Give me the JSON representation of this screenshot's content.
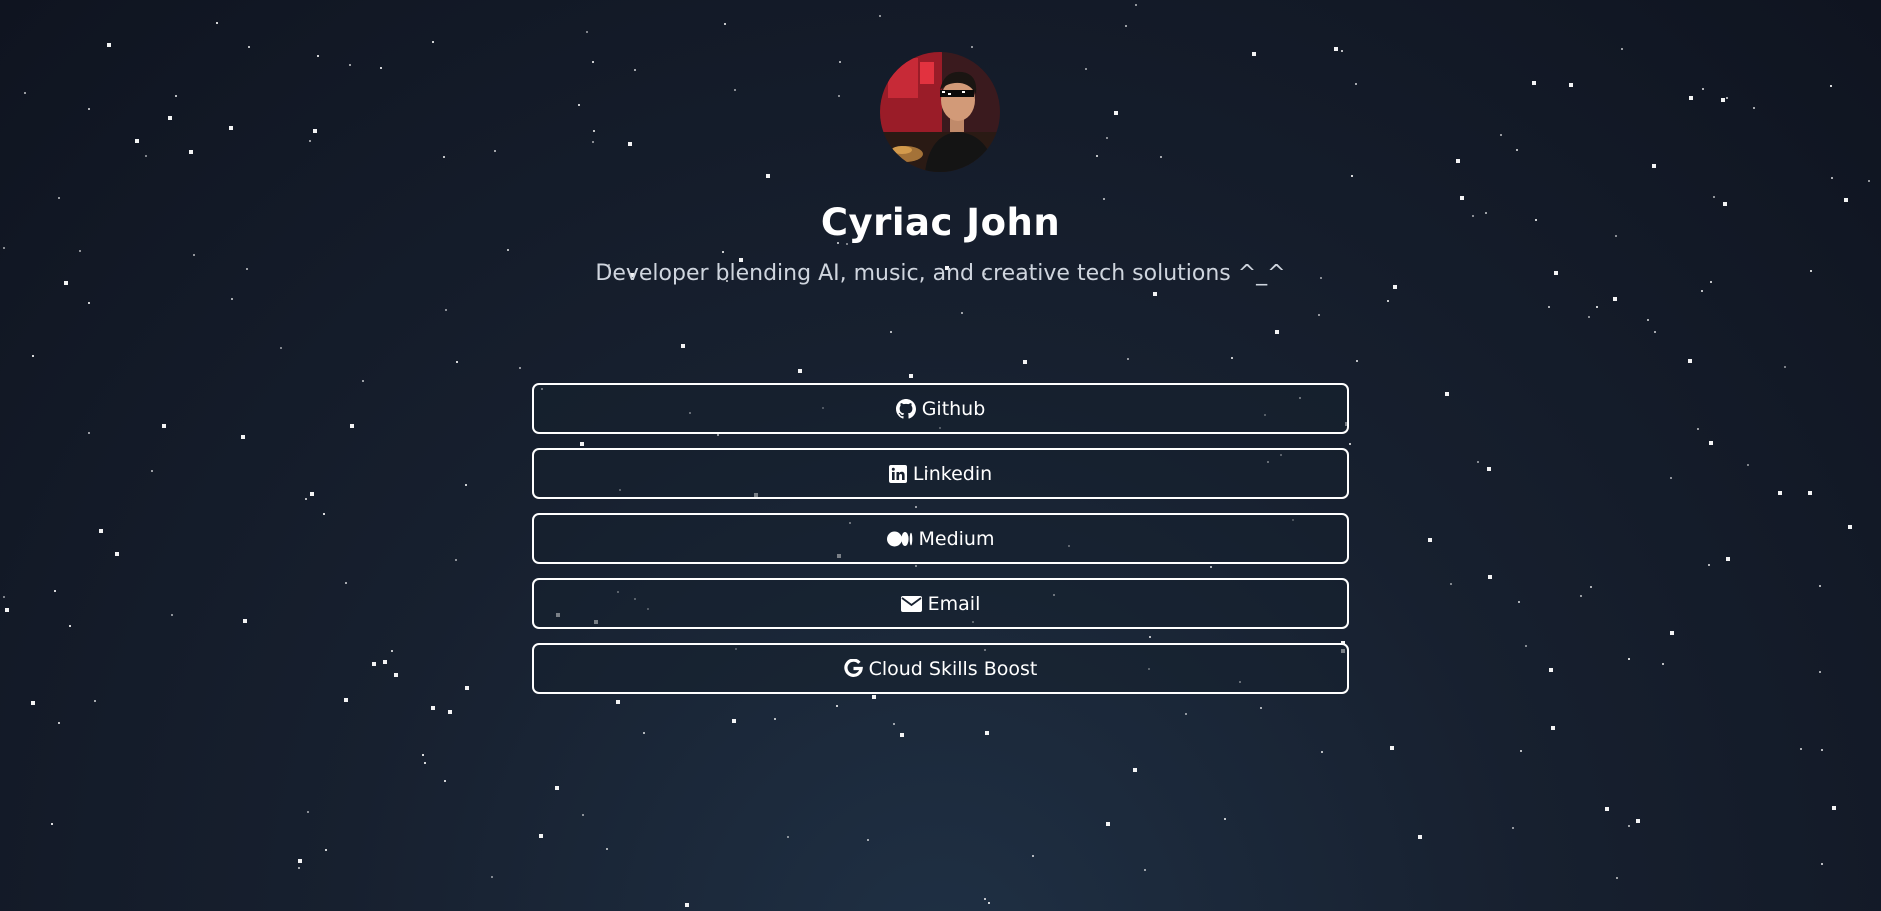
{
  "profile": {
    "name": "Cyriac John",
    "bio": "Developer blending AI, music, and creative tech solutions ^_^",
    "avatar_alt": "profile photo"
  },
  "links": [
    {
      "label": "Github",
      "icon": "github-icon"
    },
    {
      "label": "Linkedin",
      "icon": "linkedin-icon"
    },
    {
      "label": "Medium",
      "icon": "medium-icon"
    },
    {
      "label": "Email",
      "icon": "envelope-icon"
    },
    {
      "label": "Cloud Skills Boost",
      "icon": "google-icon"
    }
  ],
  "colors": {
    "background_top": "#0f1420",
    "background_bottom": "#1f3044",
    "text": "#ffffff",
    "bio_text": "#cfd5de",
    "button_border": "#ffffff"
  }
}
